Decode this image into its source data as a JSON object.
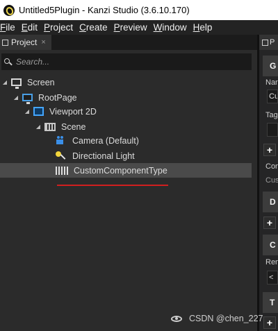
{
  "window": {
    "title": "Untitled5Plugin - Kanzi Studio (3.6.10.170)"
  },
  "menu": [
    {
      "key": "F",
      "rest": "ile"
    },
    {
      "key": "E",
      "rest": "dit"
    },
    {
      "key": "P",
      "rest": "roject"
    },
    {
      "key": "C",
      "rest": "reate"
    },
    {
      "key": "P",
      "rest": "review"
    },
    {
      "key": "W",
      "rest": "indow"
    },
    {
      "key": "H",
      "rest": "elp"
    }
  ],
  "project_panel": {
    "tab_label": "Project",
    "close_glyph": "×",
    "search_placeholder": "Search...",
    "tree": [
      {
        "label": "Screen",
        "icon": "screen-icon",
        "expander": "◢"
      },
      {
        "label": "RootPage",
        "icon": "page-icon",
        "expander": "◢"
      },
      {
        "label": "Viewport 2D",
        "icon": "viewport-icon",
        "expander": "◢"
      },
      {
        "label": "Scene",
        "icon": "scene-icon",
        "expander": "◢"
      },
      {
        "label": "Camera (Default)",
        "icon": "camera-icon"
      },
      {
        "label": "Directional Light",
        "icon": "light-icon"
      },
      {
        "label": "CustomComponentType",
        "icon": "component-icon",
        "selected": true
      }
    ]
  },
  "properties_panel": {
    "tab_label": "P",
    "headers": [
      "G",
      "D",
      "C",
      "T"
    ],
    "texts": [
      "Nar",
      "Tag",
      "Con",
      "Cus",
      "Ren"
    ],
    "fields": [
      "Cu",
      "",
      "<"
    ],
    "plus_glyph": "+"
  },
  "watermark": {
    "text": "CSDN @chen_227"
  },
  "colors": {
    "annotation_underline": "#d11f1f",
    "selection": "#4a4a4a"
  }
}
